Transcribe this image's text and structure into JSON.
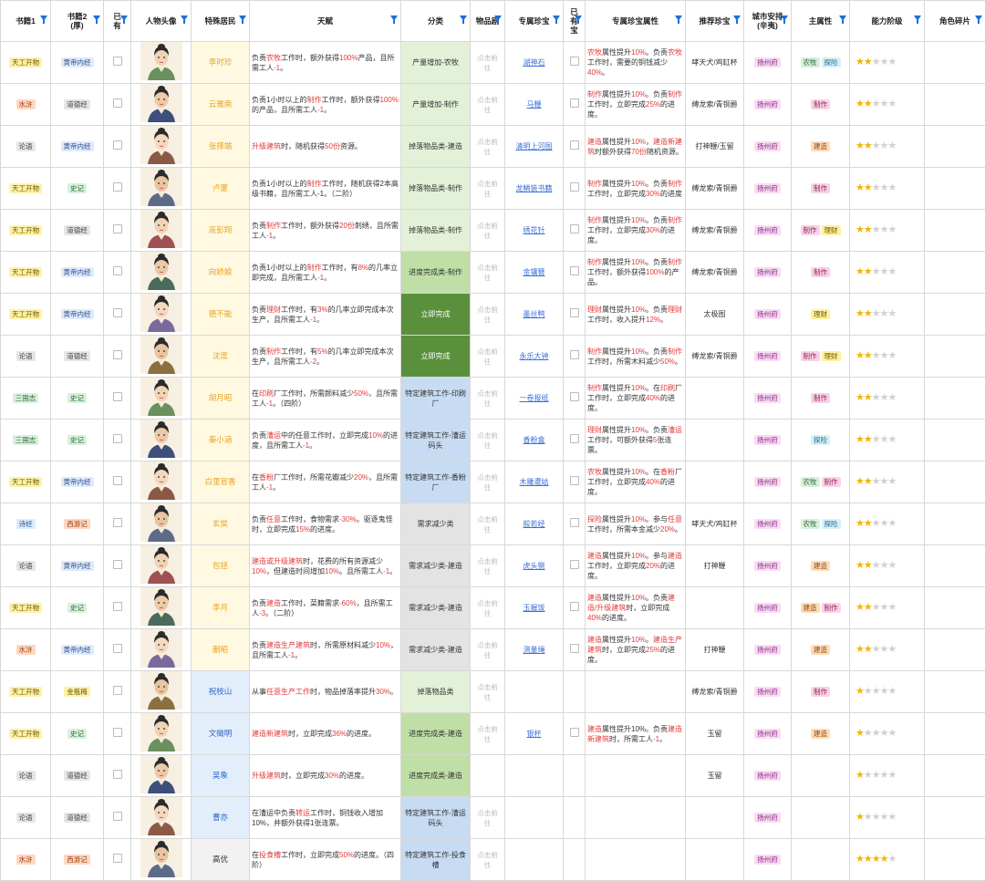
{
  "colors": {
    "filter_icon": "#1e6fd9",
    "name_yellow_bg": "#fff9e2",
    "name_yellow_text": "#e7a41c",
    "name_blue_bg": "#e3eefb",
    "name_blue_text": "#2a64c6",
    "name_gray_bg": "#f2f2f2",
    "name_gray_text": "#333333",
    "highlight_red": "#e03b3b",
    "star_on": "#f2b600",
    "star_off": "#d0d0d0"
  },
  "tag_styles": {
    "天工开物": {
      "bg": "#fff1a8",
      "fg": "#6b5a00"
    },
    "水浒": {
      "bg": "#ffd7c2",
      "fg": "#9a3d12"
    },
    "论语": {
      "bg": "#e6e6e6",
      "fg": "#444444"
    },
    "诗经": {
      "bg": "#dcebfa",
      "fg": "#2a5b9a"
    },
    "三国志": {
      "bg": "#d8f0dc",
      "fg": "#2d6b3a"
    },
    "黄帝内经": {
      "bg": "#dfeafc",
      "fg": "#2c4e8a"
    },
    "道德经": {
      "bg": "#e6e6e6",
      "fg": "#444444"
    },
    "史记": {
      "bg": "#d8f0dc",
      "fg": "#2d6b3a"
    },
    "西游记": {
      "bg": "#ffd7c2",
      "fg": "#9a3d12"
    },
    "金瓶梅": {
      "bg": "#fff1a8",
      "fg": "#6b5a00"
    },
    "扬州府": {
      "bg": "#f8dcf4",
      "fg": "#8b2a80"
    },
    "农牧": {
      "bg": "#d8f0dc",
      "fg": "#2d6b3a"
    },
    "探险": {
      "bg": "#d6f0f8",
      "fg": "#1f6c84"
    },
    "制作": {
      "bg": "#f9d2e7",
      "fg": "#8e2358"
    },
    "建造": {
      "bg": "#ffdcb8",
      "fg": "#8b4a10"
    },
    "理财": {
      "bg": "#fff0a0",
      "fg": "#6d5800"
    }
  },
  "category_styles": {
    "green_light": {
      "bg": "#e3f1d8",
      "fg": "#333333"
    },
    "green_mid": {
      "bg": "#bfdfa6",
      "fg": "#333333"
    },
    "green_dark": {
      "bg": "#5a8f3c",
      "fg": "#ffffff"
    },
    "blue_light": {
      "bg": "#c7dcf2",
      "fg": "#333333"
    },
    "gray_light": {
      "bg": "#e3e3e3",
      "fg": "#333333"
    }
  },
  "header": {
    "book1": "书籍1",
    "book2": "书籍2\n(厚)",
    "owned": "已\n有",
    "portrait": "人物头像",
    "resident": "特殊居民",
    "talent": "天赋",
    "category": "分类",
    "item_tab": "物品剧",
    "treasure": "专属珍宝",
    "owned_treasure": "已\n有\n宝",
    "treasure_attr": "专属珍宝属性",
    "recommend": "推荐珍宝",
    "city": "城市安排\n(辛夷)",
    "main_attr": "主属性",
    "ability": "能力阶级",
    "fragments": "角色碎片"
  },
  "rows": [
    {
      "book1": "天工开物",
      "book2": "黄帝内经",
      "name": "李时珍",
      "name_style": "yellow",
      "talent_html": "负责<span class='red'>农牧</span>工作时，额外获得<span class='red'>100%</span>产品，且所需工人<span class='red'>-1</span>。",
      "category": "产量增加-农牧",
      "cat_style": "green_light",
      "item": "点击前往",
      "treasure": "湖神石",
      "attr_html": "<span class='red'>农牧</span>属性提升<span class='red'>10%</span>。负责<span class='red'>农牧</span>工作时，需要的铜钱减少<span class='red'>40%</span>。",
      "recommend": "哮天犬/鸡缸杯",
      "city": "扬州府",
      "attrs": [
        "农牧",
        "探险"
      ],
      "stars": 2
    },
    {
      "book1": "水浒",
      "book2": "道德经",
      "name": "云雅南",
      "name_style": "yellow",
      "talent_html": "负责1小时以上的<span class='red'>制作</span>工作时，额外获得<span class='red'>100%</span>的产品，且所需工人<span class='red'>-1</span>。",
      "category": "产量增加-制作",
      "cat_style": "green_light",
      "item": "点击前往",
      "treasure": "马鞭",
      "attr_html": "<span class='red'>制作</span>属性提升<span class='red'>10%</span>。负责<span class='red'>制作</span>工作时，立即完成<span class='red'>25%</span>的进度。",
      "recommend": "缚龙索/青铜爵",
      "city": "扬州府",
      "attrs": [
        "制作"
      ],
      "stars": 2
    },
    {
      "book1": "论语",
      "book2": "黄帝内经",
      "name": "张择端",
      "name_style": "yellow",
      "talent_html": "<span class='red'>升级建筑</span>时，随机获得<span class='red'>50份</span>资源。",
      "category": "掉落物品类-建造",
      "cat_style": "green_light",
      "item": "点击前往",
      "treasure": "清明上河图",
      "attr_html": "<span class='red'>建造</span>属性提升<span class='red'>10%</span>，<span class='red'>建造新建筑</span>时额外获得<span class='red'>70份</span>随机资源。",
      "recommend": "打神鞭/玉留",
      "city": "扬州府",
      "attrs": [
        "建造"
      ],
      "stars": 2
    },
    {
      "book1": "天工开物",
      "book2": "史记",
      "name": "卢厦",
      "name_style": "yellow",
      "talent_html": "负责1小时以上的<span class='red'>制作</span>工作时，随机获得2本高级书籍，且所需工人-1。（二阶）",
      "category": "掉落物品类-制作",
      "cat_style": "green_light",
      "item": "点击前往",
      "treasure": "龙鳞装书籍",
      "attr_html": "<span class='red'>制作</span>属性提升<span class='red'>10%</span>。负责<span class='red'>制作</span>工作时，立即完成<span class='red'>30%</span>的进度",
      "recommend": "缚龙索/青铜爵",
      "city": "扬州府",
      "attrs": [
        "制作"
      ],
      "stars": 2
    },
    {
      "book1": "天工开物",
      "book2": "道德经",
      "name": "庞彭翔",
      "name_style": "yellow",
      "talent_html": "负责<span class='red'>制作</span>工作时，额外获得<span class='red'>20份</span>刺绣，且所需工人<span class='red'>-1</span>。",
      "category": "掉落物品类-制作",
      "cat_style": "green_light",
      "item": "点击前往",
      "treasure": "绣花针",
      "attr_html": "<span class='red'>制作</span>属性提升<span class='red'>10%</span>。负责<span class='red'>制作</span>工作时，立即完成<span class='red'>30%</span>的进度。",
      "recommend": "缚龙索/青铜爵",
      "city": "扬州府",
      "attrs": [
        "制作",
        "理财"
      ],
      "stars": 2
    },
    {
      "book1": "天工开物",
      "book2": "黄帝内经",
      "name": "向娇娘",
      "name_style": "yellow",
      "talent_html": "负责1小时以上的<span class='red'>制作</span>工作时，有<span class='red'>8%</span>的几率立即完成，且所需工人<span class='red'>-1</span>。",
      "category": "进度完成类-制作",
      "cat_style": "green_mid",
      "item": "点击前往",
      "treasure": "金镶簪",
      "attr_html": "<span class='red'>制作</span>属性提升<span class='red'>10%</span>。负责<span class='red'>制作</span>工作时，额外获得<span class='red'>100%</span>的产品。",
      "recommend": "缚龙索/青铜爵",
      "city": "扬州府",
      "attrs": [
        "制作"
      ],
      "stars": 2
    },
    {
      "book1": "天工开物",
      "book2": "黄帝内经",
      "name": "德不能",
      "name_style": "yellow",
      "talent_html": "负责<span class='red'>理财</span>工作时，有<span class='red'>3%</span>的几率立即完成本次生产，且所需工人<span class='red'>-1</span>。",
      "category": "立即完成",
      "cat_style": "green_dark",
      "item": "点击前往",
      "treasure": "墨丝鸭",
      "attr_html": "<span class='red'>理财</span>属性提升<span class='red'>10%</span>。负责<span class='red'>理财</span>工作时，收入提升<span class='red'>12%</span>。",
      "recommend": "太极图",
      "city": "扬州府",
      "attrs": [
        "理财"
      ],
      "stars": 2
    },
    {
      "book1": "论语",
      "book2": "道德经",
      "name": "沈度",
      "name_style": "yellow",
      "talent_html": "负责<span class='red'>制作</span>工作时，有<span class='red'>5%</span>的几率立即完成本次生产，且所需工人<span class='red'>-2</span>。",
      "category": "立即完成",
      "cat_style": "green_dark",
      "item": "点击前往",
      "treasure": "永乐大钟",
      "attr_html": "<span class='red'>制作</span>属性提升<span class='red'>10%</span>。负责<span class='red'>制作</span>工作时，所需木料减少<span class='red'>50%</span>。",
      "recommend": "缚龙索/青铜爵",
      "city": "扬州府",
      "attrs": [
        "制作",
        "理财"
      ],
      "stars": 2
    },
    {
      "book1": "三国志",
      "book2": "史记",
      "name": "胡月昭",
      "name_style": "yellow",
      "talent_html": "在<span class='red'>印刷</span>厂工作时，所需颜料减少<span class='red'>50%</span>，且所需工人<span class='red'>-1</span>。（四阶）",
      "category": "特定建筑工作-印刷厂",
      "cat_style": "blue_light",
      "item": "点击前往",
      "treasure": "一卷报纸",
      "attr_html": "<span class='red'>制作</span>属性提升<span class='red'>10%</span>。在<span class='red'>印刷</span>厂工作时，立即完成<span class='red'>40%</span>的进度。",
      "recommend": "",
      "city": "扬州府",
      "attrs": [
        "制作"
      ],
      "stars": 2
    },
    {
      "book1": "三国志",
      "book2": "史记",
      "name": "秦小涵",
      "name_style": "yellow",
      "talent_html": "负责<span class='red'>漕运</span>中的任意工作时，立即完成<span class='red'>10%</span>的进度，且所需工人<span class='red'>-1</span>。",
      "category": "特定建筑工作-漕运码头",
      "cat_style": "blue_light",
      "item": "点击前往",
      "treasure": "香粉盒",
      "attr_html": "<span class='red'>理财</span>属性提升<span class='red'>10%</span>。负责<span class='red'>漕运</span>工作时，可额外获得<span class='red'>5</span>张连票。",
      "recommend": "",
      "city": "扬州府",
      "attrs": [
        "探险"
      ],
      "stars": 2
    },
    {
      "book1": "天工开物",
      "book2": "黄帝内经",
      "name": "白里官香",
      "name_style": "yellow",
      "talent_html": "在<span class='red'>香粉</span>厂工作时，所需花瓣减少<span class='red'>20%</span>，且所需工人<span class='red'>-1</span>。",
      "category": "特定建筑工作-香粉厂",
      "cat_style": "blue_light",
      "item": "点击前往",
      "treasure": "木雕遭姑",
      "attr_html": "<span class='red'>农牧</span>属性提升<span class='red'>10%</span>。在<span class='red'>香粉</span>厂工作时，立即完成<span class='red'>40%</span>的进度。",
      "recommend": "",
      "city": "扬州府",
      "attrs": [
        "农牧",
        "制作"
      ],
      "stars": 2
    },
    {
      "book1": "诗经",
      "book2": "西游记",
      "name": "玄奘",
      "name_style": "yellow",
      "talent_html": "负责<span class='red'>任意</span>工作时，食物需求<span class='red'>-30%</span>。驱逐鬼怪时，立即完成<span class='red'>15%</span>的进度。",
      "category": "需求减少类",
      "cat_style": "gray_light",
      "item": "点击前往",
      "treasure": "般若经",
      "attr_html": "<span class='red'>探险</span>属性提升<span class='red'>10%</span>。参与<span class='red'>任意</span>工作时，所需本金减少<span class='red'>20%</span>。",
      "recommend": "哮天犬/鸡缸杯",
      "city": "扬州府",
      "attrs": [
        "农牧",
        "探险"
      ],
      "stars": 2
    },
    {
      "book1": "论语",
      "book2": "黄帝内经",
      "name": "包拯",
      "name_style": "yellow",
      "talent_html": "<span class='red'>建造或升级建筑</span>时，花费的所有资源减少<span class='red'>10%</span>，但建造时间增加<span class='red'>10%</span>。且所需工人<span class='red'>-1</span>。",
      "category": "需求减少类-建造",
      "cat_style": "gray_light",
      "item": "点击前往",
      "treasure": "虎头铡",
      "attr_html": "<span class='red'>建造</span>属性提升<span class='red'>10%</span>。参与<span class='red'>建造</span>工作时，立即完成<span class='red'>20%</span>的进度。",
      "recommend": "打神鞭",
      "city": "扬州府",
      "attrs": [
        "建造"
      ],
      "stars": 2
    },
    {
      "book1": "天工开物",
      "book2": "史记",
      "name": "李月",
      "name_style": "yellow",
      "talent_html": "负责<span class='red'>建造</span>工作时，菜籍需求<span class='red'>-60%</span>，且所需工人<span class='red'>-3</span>。（二阶）",
      "category": "需求减少类-建造",
      "cat_style": "gray_light",
      "item": "点击前往",
      "treasure": "玉握饭",
      "attr_html": "<span class='red'>建造</span>属性提升<span class='red'>10%</span>。负责<span class='red'>建造/升级建筑</span>时，立即完成<span class='red'>40%</span>的进度。",
      "recommend": "",
      "city": "扬州府",
      "attrs": [
        "建造",
        "制作"
      ],
      "stars": 2
    },
    {
      "book1": "水浒",
      "book2": "黄帝内经",
      "name": "蒯昭",
      "name_style": "yellow",
      "talent_html": "负责<span class='red'>建造生产建筑</span>时，所需原材料减少<span class='red'>10%</span>，且所需工人<span class='red'>-1</span>。",
      "category": "需求减少类-建造",
      "cat_style": "gray_light",
      "item": "点击前往",
      "treasure": "测量绳",
      "attr_html": "<span class='red'>建造</span>属性提升<span class='red'>10%</span>。<span class='red'>建造生产建筑</span>时，立即完成<span class='red'>25%</span>的进度。",
      "recommend": "打神鞭",
      "city": "扬州府",
      "attrs": [
        "建造"
      ],
      "stars": 2
    },
    {
      "book1": "天工开物",
      "book2": "金瓶梅",
      "name": "祝枝山",
      "name_style": "blue",
      "talent_html": "从事<span class='red'>任意生产工作</span>时，物品掉落率提升<span class='red'>30%</span>。",
      "category": "掉落物品类",
      "cat_style": "green_light",
      "item": "点击前往",
      "treasure": "",
      "attr_html": "",
      "recommend": "缚龙索/青铜爵",
      "city": "扬州府",
      "attrs": [
        "制作"
      ],
      "stars": 1
    },
    {
      "book1": "天工开物",
      "book2": "史记",
      "name": "文徵明",
      "name_style": "blue",
      "talent_html": "<span class='red'>建造新建筑</span>时，立即完成<span class='red'>36%</span>的进度。",
      "category": "进度完成类-建造",
      "cat_style": "green_mid",
      "item": "点击前往",
      "treasure": "银杯",
      "attr_html": "<span class='red'>建造</span>属性提升10%。负责<span class='red'>建造新建筑</span>时，所需工人<span class='red'>-1</span>。",
      "recommend": "玉留",
      "city": "扬州府",
      "attrs": [
        "建造"
      ],
      "stars": 1
    },
    {
      "book1": "论语",
      "book2": "道德经",
      "name": "吴象",
      "name_style": "blue",
      "talent_html": "<span class='red'>升级建筑</span>时，立即完成<span class='red'>30%</span>的进度。",
      "category": "进度完成类-建造",
      "cat_style": "green_mid",
      "item": "",
      "treasure": "",
      "attr_html": "",
      "recommend": "玉留",
      "city": "扬州府",
      "attrs": [],
      "stars": 1
    },
    {
      "book1": "论语",
      "book2": "道德经",
      "name": "曹亦",
      "name_style": "blue",
      "talent_html": "在漕运中负责<span class='red'>转运</span>工作时，铜钱收入增加10%，并额外获得1张连票。",
      "category": "特定建筑工作-漕运码头",
      "cat_style": "blue_light",
      "item": "点击前往",
      "treasure": "",
      "attr_html": "",
      "recommend": "",
      "city": "扬州府",
      "attrs": [],
      "stars": 1
    },
    {
      "book1": "水浒",
      "book2": "西游记",
      "name": "高优",
      "name_style": "gray",
      "talent_html": "在<span class='red'>投食槽</span>工作时，立即完成<span class='red'>50%</span>的进度。（四阶）",
      "category": "特定建筑工作-投食槽",
      "cat_style": "blue_light",
      "item": "点击前往",
      "treasure": "",
      "attr_html": "",
      "recommend": "",
      "city": "扬州府",
      "attrs": [],
      "stars": 4
    }
  ]
}
